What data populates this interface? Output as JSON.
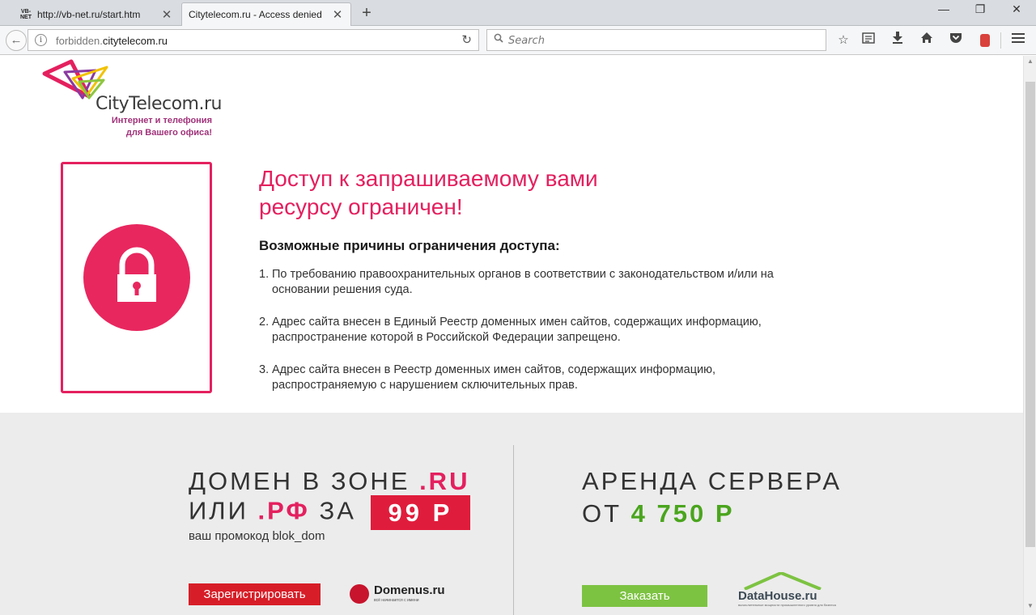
{
  "browser": {
    "tabs": [
      {
        "favicon_text": "VB-NET",
        "title": "http://vb-net.ru/start.htm",
        "active": false
      },
      {
        "title": "Citytelecom.ru - Access denied",
        "active": true
      }
    ],
    "url": {
      "prefix": "forbidden.",
      "domain": "citytelecom.ru"
    },
    "search_placeholder": "Search",
    "window_controls": {
      "minimize": "—",
      "restore": "❐",
      "close": "✕"
    }
  },
  "logo": {
    "name": "CityTelecom.ru",
    "tagline_line1": "Интернет и телефония",
    "tagline_line2": "для Вашего офиса!",
    "colors": [
      "#e4205f",
      "#8a3aa0",
      "#f2c200",
      "#8ec63f"
    ]
  },
  "main": {
    "heading_line1": "Доступ к запрашиваемому вами",
    "heading_line2": "ресурсу ограничен!",
    "subheading": "Возможные причины ограничения доступа:",
    "reasons": [
      {
        "num": "1.",
        "text": "По требованию правоохранительных органов в соответствии с законодательством и/или на основании решения суда."
      },
      {
        "num": "2.",
        "text": "Адрес сайта внесен в Единый Реестр доменных имен сайтов, содержащих информацию, распространение которой в Российской Федерации запрещено."
      },
      {
        "num": "3.",
        "text": "Адрес сайта внесен в Реестр доменных имен сайтов, содержащих информацию, распространяемую с нарушением сключительных прав."
      }
    ],
    "accent_color": "#e4205f"
  },
  "promo": {
    "domain": {
      "line1_text": "ДОМЕН В ЗОНЕ ",
      "line1_accent": ".RU",
      "line2_text1": "ИЛИ ",
      "line2_accent": ".РФ",
      "line2_text2": " ЗА",
      "price": "99 Р",
      "promo_code": "ваш промокод blok_dom",
      "button": "Зарегистрировать",
      "brand_name": "Domenus.ru",
      "brand_tagline": "всё начинается с имени"
    },
    "server": {
      "line1": "АРЕНДА СЕРВЕРА",
      "line2_text": "ОТ ",
      "line2_price": "4 750 Р",
      "button": "Заказать",
      "brand_name": "DataHouse.ru",
      "brand_tagline": "вычислительные мощности промышленного уровня для бизнеса"
    },
    "colors": {
      "red": "#e01c3c",
      "green": "#4aa51d",
      "button_green": "#7dc342"
    }
  }
}
